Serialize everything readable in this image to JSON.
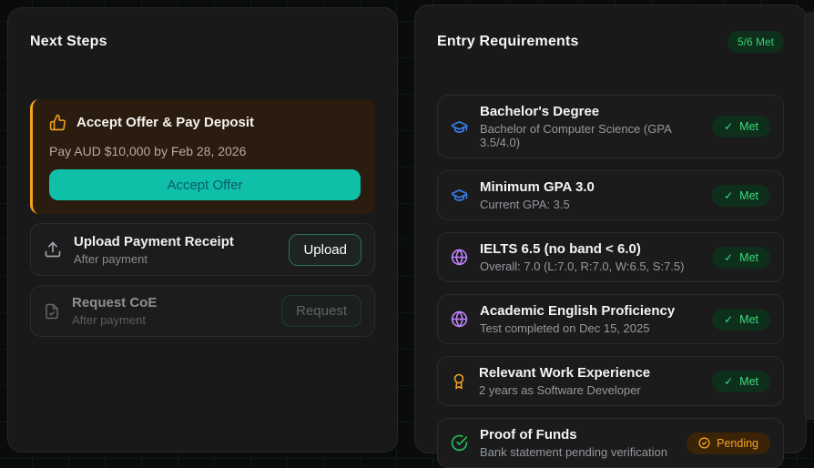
{
  "theme": {
    "accent_teal": "#0fc0a9",
    "accent_orange": "#f6a21a",
    "met_green": "#3bdc7c",
    "pending_orange": "#f5a623",
    "icon_blue": "#3b82f6",
    "icon_purple": "#c084fc",
    "icon_green": "#22c55e"
  },
  "icons": {
    "check": "✓"
  },
  "next_steps": {
    "title": "Next Steps",
    "primary_step": {
      "icon": "thumbs-up-icon",
      "title": "Accept Offer & Pay Deposit",
      "description": "Pay AUD $10,000 by Feb 28, 2026",
      "button_label": "Accept Offer"
    },
    "steps": [
      {
        "icon": "upload-icon",
        "title": "Upload Payment Receipt",
        "subtitle": "After payment",
        "button_label": "Upload",
        "enabled": true
      },
      {
        "icon": "file-check-icon",
        "title": "Request CoE",
        "subtitle": "After payment",
        "button_label": "Request",
        "enabled": false
      }
    ]
  },
  "entry_requirements": {
    "title": "Entry Requirements",
    "summary_badge": "5/6 Met",
    "items": [
      {
        "icon": "graduation-cap-icon",
        "title": "Bachelor's Degree",
        "subtitle": "Bachelor of Computer Science (GPA 3.5/4.0)",
        "status": "Met"
      },
      {
        "icon": "graduation-cap-icon",
        "title": "Minimum GPA 3.0",
        "subtitle": "Current GPA: 3.5",
        "status": "Met"
      },
      {
        "icon": "globe-icon",
        "title": "IELTS 6.5 (no band < 6.0)",
        "subtitle": "Overall: 7.0 (L:7.0, R:7.0, W:6.5, S:7.5)",
        "status": "Met"
      },
      {
        "icon": "globe-icon",
        "title": "Academic English Proficiency",
        "subtitle": "Test completed on Dec 15, 2025",
        "status": "Met"
      },
      {
        "icon": "award-icon",
        "title": "Relevant Work Experience",
        "subtitle": "2 years as Software Developer",
        "status": "Met"
      },
      {
        "icon": "check-circle-icon",
        "title": "Proof of Funds",
        "subtitle": "Bank statement pending verification",
        "status": "Pending"
      }
    ]
  }
}
